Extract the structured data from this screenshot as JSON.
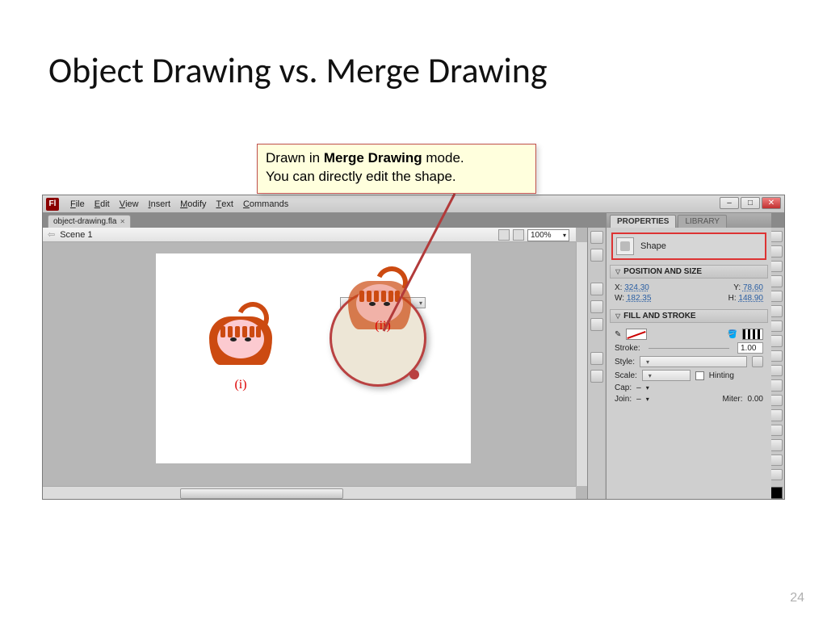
{
  "slide": {
    "title": "Object Drawing vs. Merge Drawing",
    "page_number": "24",
    "callout_pre": "Drawn in ",
    "callout_bold": "Merge Drawing",
    "callout_post": " mode.",
    "callout_line2": "You can directly edit the shape."
  },
  "app": {
    "logo": "F",
    "menu": [
      "File",
      "Edit",
      "View",
      "Insert",
      "Modify",
      "Text",
      "Commands"
    ],
    "doc_tab": "object-drawing.fla",
    "scene": "Scene 1",
    "zoom": "100%",
    "stage_labels": {
      "left": "(i)",
      "right": "(ii)"
    }
  },
  "panel": {
    "tabs": {
      "active": "PROPERTIES",
      "inactive": "LIBRARY"
    },
    "object_type": "Shape",
    "sections": {
      "pos": {
        "header": "POSITION AND SIZE",
        "x_label": "X:",
        "x": "324.30",
        "y_label": "Y:",
        "y": "78.60",
        "w_label": "W:",
        "w": "182.35",
        "h_label": "H:",
        "h": "148.90"
      },
      "fill": {
        "header": "FILL AND STROKE",
        "stroke_label": "Stroke:",
        "stroke_val": "1.00",
        "style_label": "Style:",
        "scale_label": "Scale:",
        "hinting_label": "Hinting",
        "cap_label": "Cap:",
        "cap_val": "–",
        "join_label": "Join:",
        "join_val": "–",
        "miter_label": "Miter:",
        "miter_val": "0.00"
      }
    }
  }
}
